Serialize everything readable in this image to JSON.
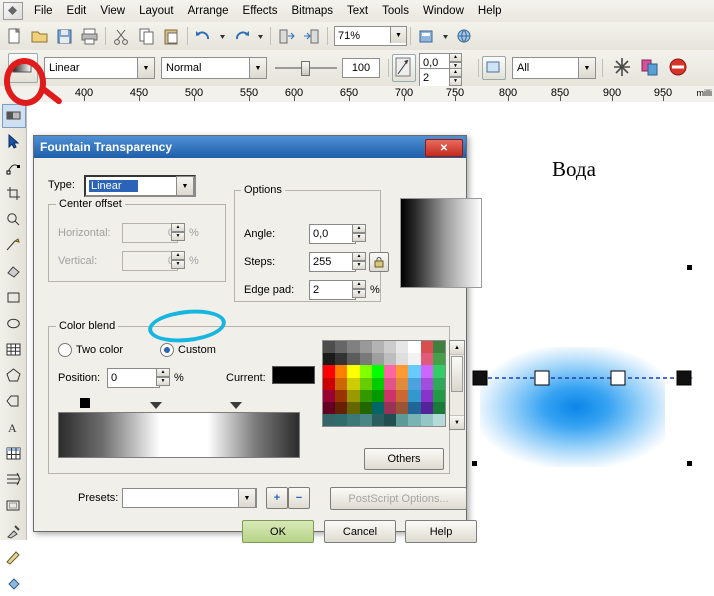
{
  "app": {
    "title": "CorelDRAW",
    "menu": [
      "File",
      "Edit",
      "View",
      "Layout",
      "Arrange",
      "Effects",
      "Bitmaps",
      "Text",
      "Tools",
      "Window",
      "Help"
    ]
  },
  "toolbar1": {
    "zoom_value": "71%",
    "buttons": [
      "new-document",
      "open-document",
      "save-document",
      "print",
      "cut",
      "copy",
      "paste",
      "undo",
      "redo",
      "import",
      "export",
      "application-launcher",
      "corel-online"
    ]
  },
  "propertybar": {
    "tool_icon": "interactive-transparency-tool",
    "type_value": "Linear",
    "merge_value": "Normal",
    "transparency_value": "100",
    "angle_value": "0,0",
    "edge_pad_value": "2",
    "apply_to_value": "All",
    "buttons": [
      "transparency-angle-spinner",
      "edge-pad-spinner",
      "freeze-transparency",
      "copy-transparency",
      "clear-transparency"
    ]
  },
  "ruler": {
    "unit": "milli",
    "labels": [
      "400",
      "450",
      "500",
      "550",
      "600",
      "650",
      "700",
      "750",
      "800",
      "850",
      "900",
      "950"
    ]
  },
  "toolbox": {
    "tools": [
      "pick-tool",
      "shape-tool",
      "crop-tool",
      "zoom-tool",
      "freehand-tool",
      "smart-fill-tool",
      "rectangle-tool",
      "ellipse-tool",
      "graph-paper-tool",
      "polygon-tool",
      "basic-shapes-tool",
      "text-tool",
      "table-tool",
      "interactive-blend-tool",
      "interactive-transparency-tool",
      "eyedropper-tool",
      "outline-tool",
      "fill-tool",
      "interactive-fill-tool"
    ]
  },
  "canvas": {
    "artwork_text": "Вода"
  },
  "dialog": {
    "title": "Fountain Transparency",
    "close_label": "✕",
    "type_label": "Type:",
    "type_value": "Linear",
    "center_offset_label": "Center offset",
    "horizontal_label": "Horizontal:",
    "horizontal_value": "0",
    "horizontal_unit": "%",
    "vertical_label": "Vertical:",
    "vertical_value": "0",
    "vertical_unit": "%",
    "options_label": "Options",
    "angle_label": "Angle:",
    "angle_value": "0,0",
    "steps_label": "Steps:",
    "steps_value": "255",
    "edge_pad_label": "Edge pad:",
    "edge_pad_value": "2",
    "edge_pad_unit": "%",
    "lock_icon": "lock-icon",
    "color_blend_label": "Color blend",
    "two_color_label": "Two color",
    "custom_label": "Custom",
    "position_label": "Position:",
    "position_value": "0",
    "position_unit": "%",
    "current_label": "Current:",
    "current_color": "#000000",
    "others_label": "Others",
    "presets_label": "Presets:",
    "presets_value": "",
    "preset_add_label": "+",
    "preset_remove_label": "−",
    "postscript_label": "PostScript Options...",
    "ok_label": "OK",
    "cancel_label": "Cancel",
    "help_label": "Help",
    "palette_rows": [
      [
        "#4d4d4d",
        "#666666",
        "#808080",
        "#999999",
        "#b3b3b3",
        "#cccccc",
        "#e6e6e6",
        "#ffffff",
        "#d94f4f",
        "#3f7f3f"
      ],
      [
        "#1a1a1a",
        "#333333",
        "#5c5c5c",
        "#7a7a7a",
        "#9e9e9e",
        "#bdbdbd",
        "#dedede",
        "#f2f2f2",
        "#e05a7a",
        "#45a049"
      ],
      [
        "#ff0000",
        "#ff7f00",
        "#ffff00",
        "#7fff00",
        "#00ff00",
        "#ff66a3",
        "#ff9933",
        "#66ccff",
        "#cc66ff",
        "#33cc66"
      ],
      [
        "#cc0000",
        "#cc6600",
        "#cccc00",
        "#66cc00",
        "#00cc00",
        "#e0548a",
        "#e08a3c",
        "#4aa3dd",
        "#a34ddd",
        "#2fa85a"
      ],
      [
        "#990033",
        "#993300",
        "#999900",
        "#339900",
        "#009900",
        "#cc3366",
        "#cc6633",
        "#3399cc",
        "#8833cc",
        "#229944"
      ],
      [
        "#660022",
        "#662200",
        "#666600",
        "#226600",
        "#006666",
        "#993355",
        "#995533",
        "#226699",
        "#552299",
        "#1a7a38"
      ],
      [
        "#336666",
        "#2f6b6b",
        "#3d7878",
        "#4a8585",
        "#2b5f5f",
        "#1f4f4f",
        "#5c9a9a",
        "#79b3b3",
        "#95c6c6",
        "#b5dada"
      ]
    ]
  },
  "annotations": {
    "red_circle": "highlight-transparency-tool",
    "blue_circle": "highlight-custom-radio"
  }
}
